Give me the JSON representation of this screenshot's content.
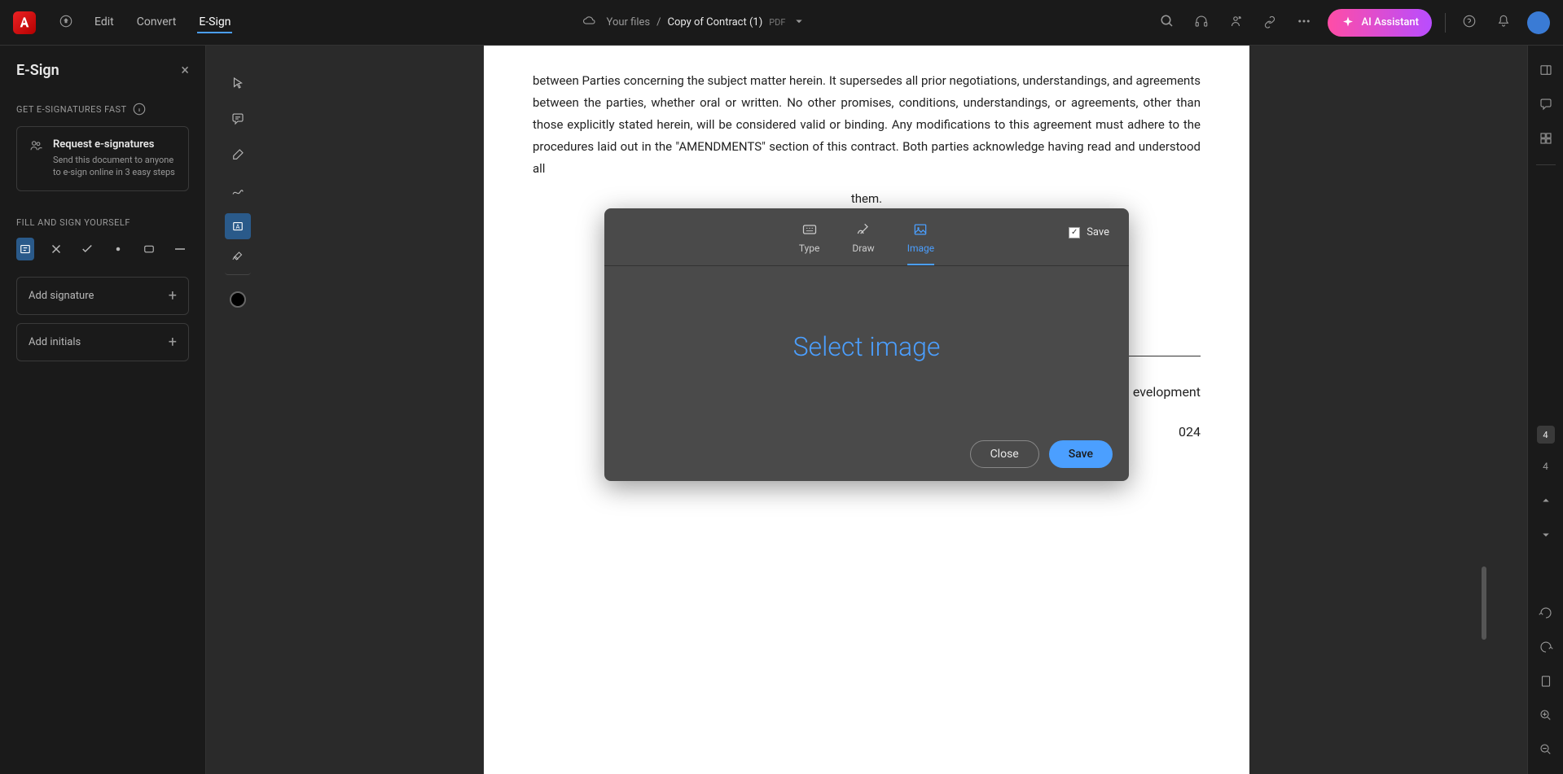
{
  "header": {
    "menu_edit": "Edit",
    "menu_convert": "Convert",
    "menu_esign": "E-Sign",
    "breadcrumb_files": "Your files",
    "file_name": "Copy of Contract (1)",
    "pdf_badge": "PDF",
    "ai_assistant": "AI Assistant"
  },
  "sidebar": {
    "title": "E-Sign",
    "section_signatures": "GET E-SIGNATURES FAST",
    "request_title": "Request e-signatures",
    "request_desc": "Send this document to anyone to e-sign online in 3 easy steps",
    "section_fill": "FILL AND SIGN YOURSELF",
    "add_signature": "Add signature",
    "add_initials": "Add initials"
  },
  "document": {
    "paragraph": "between Parties concerning the subject matter herein. It supersedes all prior negotiations, understandings, and agreements between the parties, whether oral or written. No other promises, conditions, understandings, or agreements, other than those explicitly stated herein, will be considered valid or binding. Any modifications to this agreement must adhere to the procedures laid out in the \"AMENDMENTS\" section of this contract. Both parties acknowledge having read and understood all",
    "paragraph_end": "them.",
    "sig_dept": "evelopment",
    "sig_date": "024"
  },
  "modal": {
    "tab_type": "Type",
    "tab_draw": "Draw",
    "tab_image": "Image",
    "save_label": "Save",
    "select_image": "Select image",
    "btn_close": "Close",
    "btn_save": "Save"
  },
  "page_controls": {
    "current_page": "4",
    "total_page": "4"
  }
}
